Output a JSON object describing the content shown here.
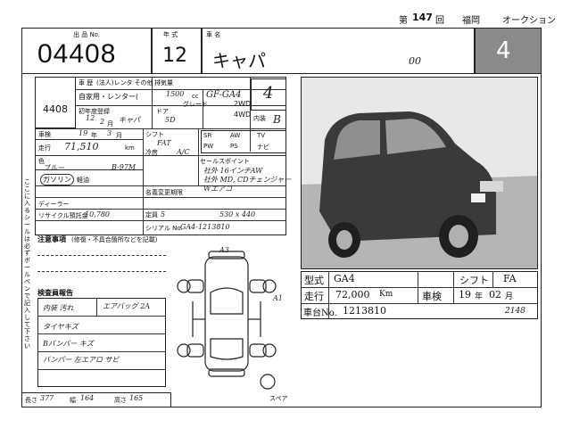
{
  "header": {
    "number_label": "第",
    "sheet_number": "147",
    "number_suffix": "回",
    "venue": "福岡",
    "event": "オークション"
  },
  "top_row": {
    "lot_label": "出 品 No.",
    "lot_number": "04408",
    "year_label": "年 式",
    "year": "12",
    "name_label": "車 名",
    "car_name": "キャパ",
    "grade_note": "00",
    "score": "4"
  },
  "left_info": {
    "lot_small": "4408",
    "usage_label": "車 歴",
    "usage_options": "(法人)レンタ その他",
    "usage_values": "自家用・レンター(",
    "displacement_label": "排気量",
    "displacement": "1500",
    "displacement_unit": "cc",
    "model_code": "GF-GA4",
    "first_reg_label": "初年度登録",
    "first_reg_year": "12",
    "first_reg_month": "2",
    "first_reg_month_unit": "月",
    "first_reg_name": "キャパ",
    "door_label": "ドア",
    "doors": "5D",
    "grade_label": "グレード",
    "drive_2wd": "2WD",
    "drive_4wd": "4WD",
    "score_hand": "4",
    "interior_label": "内装",
    "interior_grade": "B",
    "shaken_label": "車検",
    "shaken_year": "19",
    "shaken_year_unit": "年",
    "shaken_month": "3",
    "shaken_month_unit": "月",
    "mileage_label": "走行",
    "mileage": "71,510",
    "mileage_unit": "km",
    "color_label": "色",
    "color": "ブルー",
    "color_code": "B-97M",
    "fuel_label": "ガソリン",
    "fuel_other": "軽油",
    "recycle_label": "リサイクル預託金",
    "recycle_value": "10,780",
    "dealer_label": "ディーラー",
    "accessories_label": "付属品",
    "shift_label": "シフト",
    "shift": "FAT",
    "ac_label": "冷房",
    "ac": "A/C",
    "equipment_sr": "SR",
    "equipment_aw": "AW",
    "equipment_tv": "TV",
    "equipment_pw": "PW",
    "equipment_ps": "PS",
    "equipment_navi": "ナビ",
    "sales_point_label": "セールスポイント",
    "sales_point_1": "社外 16インチAW",
    "sales_point_2": "社外 MD, CDチェンジャー",
    "sales_point_3": "Wエアコ",
    "change_label": "名義変更期限",
    "capacity_label": "定員",
    "capacity": "5",
    "dimensions": "530 x 440",
    "serial_label": "シリアル No.",
    "serial": "GA4-1213810"
  },
  "notes": {
    "heading": "注意事項",
    "heading_detail": "(修復・不具合箇所などを記載)",
    "side_note": "ここに入るシールは必ずボールペンで記入して下さい",
    "inspector_heading": "検査員報告",
    "report_1": "内装 汚れ",
    "report_2": "タイヤキズ",
    "report_3": "Bバンパー キズ",
    "report_4": "バンパー 左エアロ サビ",
    "report_side": "エアバッグ 2A",
    "labels_a": "A3",
    "labels_a1": "A1",
    "spare_label": "スペア",
    "length_label": "長さ",
    "length": "377",
    "width_label": "幅",
    "width": "164",
    "height_label": "高さ",
    "height": "165"
  },
  "bottom_right": {
    "type_label": "型式",
    "type": "GA4",
    "shift_label": "シフト",
    "shift": "FA",
    "mileage_label": "走行",
    "mileage": "72,000",
    "mileage_unit": "Km",
    "shaken_label": "車検",
    "shaken_year": "19",
    "shaken_year_unit": "年",
    "shaken_month": "02",
    "shaken_month_unit": "月",
    "chassis_label": "車台No.",
    "chassis": "1213810",
    "chassis_note": "2148"
  }
}
